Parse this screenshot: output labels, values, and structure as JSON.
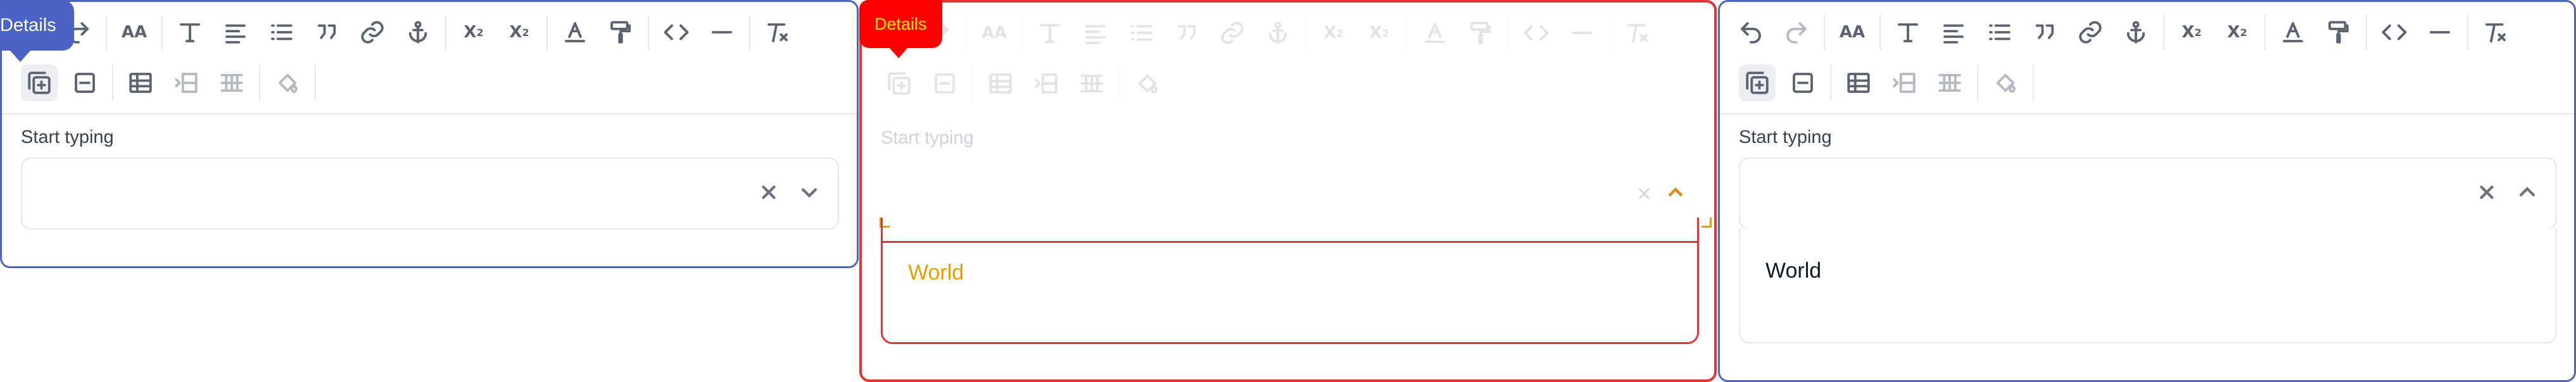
{
  "panels": [
    {
      "id": "left",
      "tag": "Details",
      "field_label": "Start typing",
      "field_value": "",
      "dropdown_open": false
    },
    {
      "id": "middle",
      "tag": "Details",
      "field_label": "Start typing",
      "option": "World",
      "dropdown_open": true
    },
    {
      "id": "right",
      "field_label": "Start typing",
      "field_value": "",
      "dropdown_open": true,
      "options": [
        "World"
      ]
    }
  ],
  "toolbar": {
    "row1": [
      "undo-icon",
      "redo-icon",
      "text-size-icon",
      "text-style-icon",
      "align-icon",
      "bullet-list-icon",
      "quote-icon",
      "link-icon",
      "anchor-icon",
      "subscript-icon",
      "superscript-icon",
      "text-color-icon",
      "format-painter-icon",
      "code-icon",
      "horizontal-rule-icon",
      "clear-format-icon"
    ],
    "row2": [
      "add-block-icon",
      "remove-block-icon",
      "table-icon",
      "insert-row-icon",
      "table-grid-icon",
      "fill-color-icon"
    ]
  },
  "colors": {
    "panel_border": "#4b63c4",
    "highlight_border": "#e53232",
    "highlight_fill": "#ff0000",
    "highlight_text": "#ffea00"
  }
}
